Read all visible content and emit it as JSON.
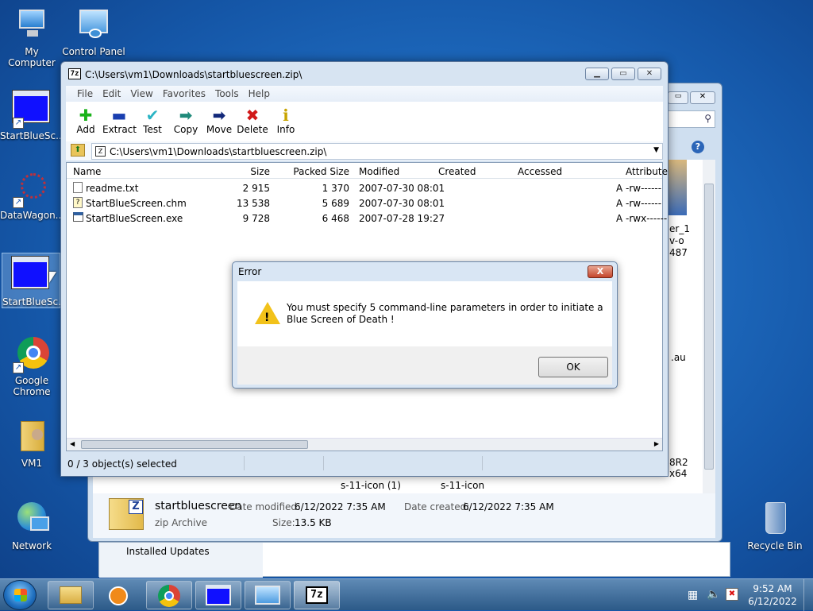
{
  "desktop": {
    "icons": [
      {
        "label": "My Computer"
      },
      {
        "label": "Control Panel"
      },
      {
        "label": "StartBlueSc..."
      },
      {
        "label": "DataWagon..."
      },
      {
        "label": "StartBlueSc..."
      },
      {
        "label": "Google Chrome"
      },
      {
        "label": "VM1"
      },
      {
        "label": "Network"
      },
      {
        "label": "Recycle Bin"
      }
    ]
  },
  "bg_window": {
    "partial_labels": [
      "er_1",
      "v-o",
      "487",
      ".au",
      "8R2",
      "x64"
    ],
    "thumbs": [
      "s-11-icon (1)",
      "s-11-icon"
    ],
    "details": {
      "name": "startbluescreen",
      "type": "zip Archive",
      "modified_label": "Date modified:",
      "modified": "6/12/2022 7:35 AM",
      "created_label": "Date created:",
      "created": "6/12/2022 7:35 AM",
      "size_label": "Size:",
      "size": "13.5 KB"
    },
    "nav_item": "Installed Updates"
  },
  "main_window": {
    "title": "C:\\Users\\vm1\\Downloads\\startbluescreen.zip\\",
    "icon_text": "7z",
    "menu": [
      "File",
      "Edit",
      "View",
      "Favorites",
      "Tools",
      "Help"
    ],
    "toolbar": [
      {
        "label": "Add",
        "icon": "plus-icon",
        "color": "#19b219"
      },
      {
        "label": "Extract",
        "icon": "minus-icon",
        "color": "#1a3fb0"
      },
      {
        "label": "Test",
        "icon": "check-icon",
        "color": "#2bb4c4"
      },
      {
        "label": "Copy",
        "icon": "copy-arrow-icon",
        "color": "#1f8a7a"
      },
      {
        "label": "Move",
        "icon": "move-arrow-icon",
        "color": "#12287a"
      },
      {
        "label": "Delete",
        "icon": "delete-x-icon",
        "color": "#d11818"
      },
      {
        "label": "Info",
        "icon": "info-icon",
        "color": "#c8a400"
      }
    ],
    "address": "C:\\Users\\vm1\\Downloads\\startbluescreen.zip\\",
    "columns": [
      "Name",
      "Size",
      "Packed Size",
      "Modified",
      "Created",
      "Accessed",
      "Attribute"
    ],
    "files": [
      {
        "name": "readme.txt",
        "size": "2 915",
        "packed": "1 370",
        "modified": "2007-07-30 08:01",
        "created": "",
        "accessed": "",
        "attr": "A -rw------"
      },
      {
        "name": "StartBlueScreen.chm",
        "size": "13 538",
        "packed": "5 689",
        "modified": "2007-07-30 08:01",
        "created": "",
        "accessed": "",
        "attr": "A -rw------"
      },
      {
        "name": "StartBlueScreen.exe",
        "size": "9 728",
        "packed": "6 468",
        "modified": "2007-07-28 19:27",
        "created": "",
        "accessed": "",
        "attr": "A -rwx------"
      }
    ],
    "status": "0 / 3 object(s) selected"
  },
  "dialog": {
    "title": "Error",
    "message": "You must specify 5 command-line parameters in order to initiate a Blue Screen of Death !",
    "ok": "OK",
    "close": "X"
  },
  "taskbar": {
    "time": "9:52 AM",
    "date": "6/12/2022",
    "tray_icons": [
      "network-icon",
      "volume-icon",
      "action-center-icon"
    ]
  }
}
